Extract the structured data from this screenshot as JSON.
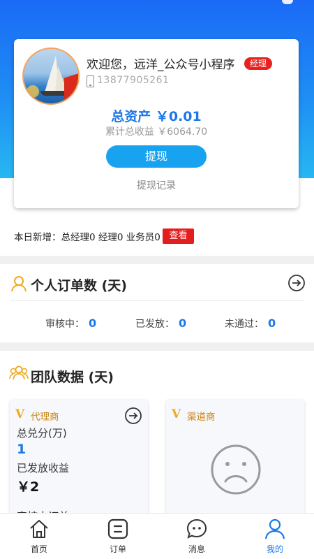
{
  "colors": {
    "primary": "#1c78e8",
    "badge_red": "#e8201e",
    "accent_gold": "#f2a91f",
    "hero_top": "#1a6af6",
    "hero_bottom": "#27b7f2"
  },
  "profile": {
    "welcome": "欢迎您，远洋_公众号小程序",
    "role_badge": "经理",
    "phone": "13877905261",
    "total_assets": "总资产 ￥0.01",
    "cumulative_income": "累计总收益 ￥6064.70",
    "withdraw_button": "提现",
    "withdraw_record": "提现记录"
  },
  "today": {
    "summary": "本日新增：总经理0 经理0 业务员0",
    "view_button": "查看"
  },
  "orders_section": {
    "title": "个人订单数 (天)",
    "stats": [
      {
        "label": "审核中：",
        "value": "0"
      },
      {
        "label": "已发放：",
        "value": "0"
      },
      {
        "label": "未通过：",
        "value": "0"
      }
    ]
  },
  "team_section": {
    "title": "团队数据 (天)",
    "agent_card": {
      "badge": "V",
      "title": "代理商",
      "points_label": "总兑分(万)",
      "points_value": "1",
      "income_label": "已发放收益",
      "income_value": "￥2",
      "cut_label": "审核中订单"
    },
    "channel_card": {
      "badge": "V",
      "title": "渠道商"
    }
  },
  "nav": {
    "items": [
      {
        "label": "首页",
        "icon": "home-icon"
      },
      {
        "label": "订单",
        "icon": "order-icon"
      },
      {
        "label": "消息",
        "icon": "message-icon"
      },
      {
        "label": "我的",
        "icon": "profile-icon",
        "active": true
      }
    ]
  }
}
